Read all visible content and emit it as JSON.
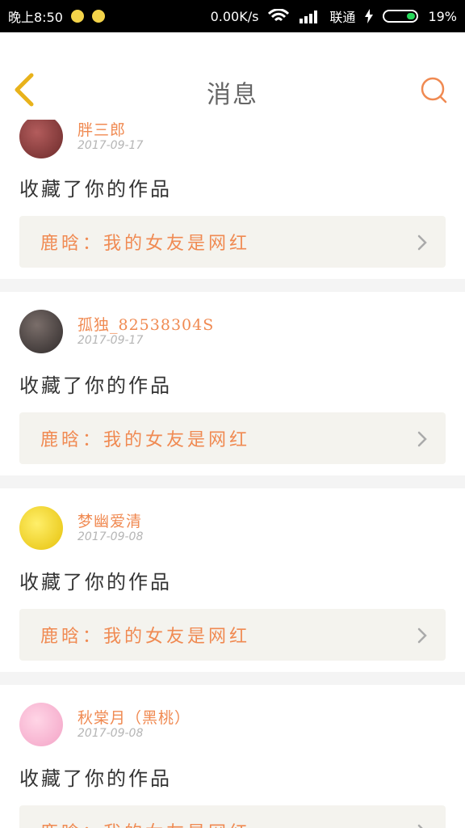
{
  "status_bar": {
    "time": "晚上8:50",
    "network_speed": "0.00K/s",
    "carrier": "联通",
    "battery": "19%",
    "battery_level": 19
  },
  "header": {
    "title": "消息",
    "back_icon": "chevron-left-icon",
    "search_icon": "search-icon"
  },
  "messages": [
    {
      "username": "胖三郎",
      "date": "2017-09-17",
      "action": "收藏了你的作品",
      "work": "鹿晗：我的女友是网红"
    },
    {
      "username": "孤独_82538304S",
      "date": "2017-09-17",
      "action": "收藏了你的作品",
      "work": "鹿晗：我的女友是网红"
    },
    {
      "username": "梦幽爱清",
      "date": "2017-09-08",
      "action": "收藏了你的作品",
      "work": "鹿晗：我的女友是网红"
    },
    {
      "username": "秋棠月（黑桃）",
      "date": "2017-09-08",
      "action": "收藏了你的作品",
      "work": "鹿晗：我的女友是网红"
    }
  ],
  "colors": {
    "accent": "#f08a52",
    "card_link_bg": "#f4f3ee",
    "divider": "#f4f4f4"
  }
}
